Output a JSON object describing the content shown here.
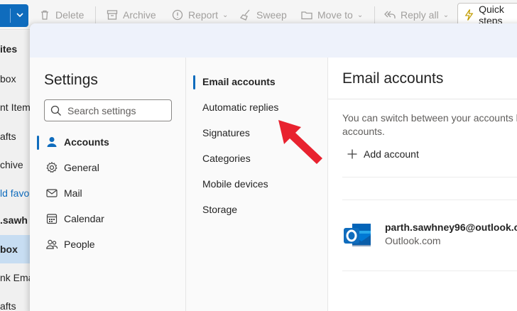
{
  "toolbar": {
    "delete_label": "Delete",
    "archive_label": "Archive",
    "report_label": "Report",
    "sweep_label": "Sweep",
    "moveto_label": "Move to",
    "replyall_label": "Reply all",
    "quicksteps_label": "Quick steps"
  },
  "leftnav": {
    "items": [
      "ites",
      "box",
      "nt Item",
      "afts",
      "chive",
      "ld favo",
      ".sawh",
      "box",
      "nk Ema",
      "afts"
    ]
  },
  "settings": {
    "title": "Settings",
    "search_placeholder": "Search settings",
    "categories": [
      {
        "label": "Accounts",
        "icon": "person-icon",
        "active": true
      },
      {
        "label": "General",
        "icon": "gear-icon",
        "active": false
      },
      {
        "label": "Mail",
        "icon": "mail-icon",
        "active": false
      },
      {
        "label": "Calendar",
        "icon": "calendar-icon",
        "active": false
      },
      {
        "label": "People",
        "icon": "people-icon",
        "active": false
      }
    ],
    "subcategories": [
      {
        "label": "Email accounts",
        "active": true
      },
      {
        "label": "Automatic replies",
        "active": false
      },
      {
        "label": "Signatures",
        "active": false
      },
      {
        "label": "Categories",
        "active": false
      },
      {
        "label": "Mobile devices",
        "active": false
      },
      {
        "label": "Storage",
        "active": false
      }
    ]
  },
  "pane": {
    "title": "Email accounts",
    "description": "You can switch between your accounts l accounts.",
    "add_account_label": "Add account",
    "account": {
      "email": "parth.sawhney96@outlook.co",
      "type": "Outlook.com"
    }
  },
  "colors": {
    "accent": "#0f6cbd",
    "annotation_arrow": "#e8222f"
  }
}
